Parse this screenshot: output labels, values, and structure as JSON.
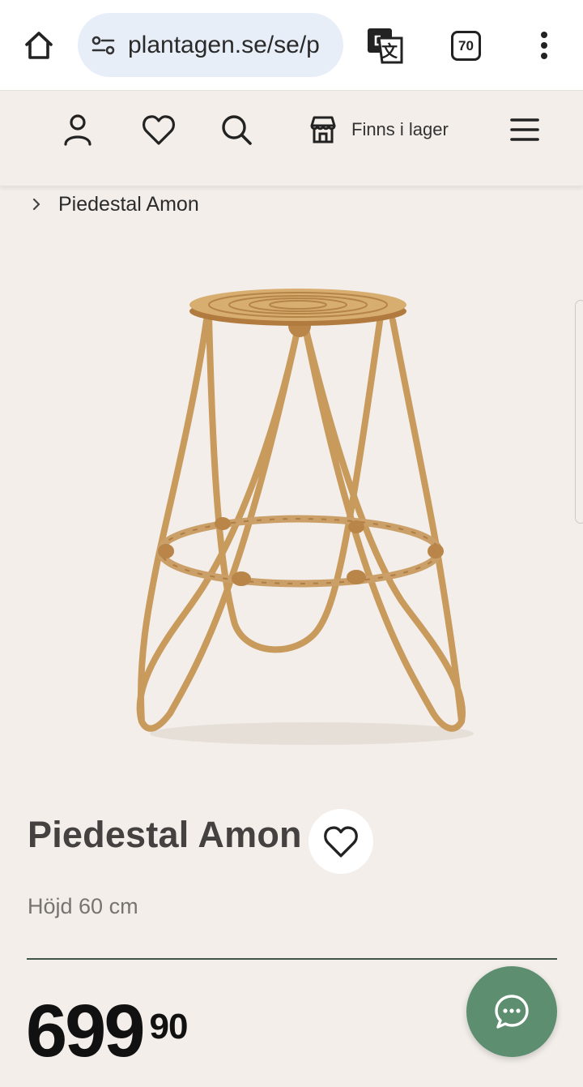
{
  "browser": {
    "url": "plantagen.se/se/p",
    "tab_count": "70"
  },
  "header": {
    "store_label": "Finns i lager"
  },
  "breadcrumb": {
    "current": "Piedestal Amon"
  },
  "product": {
    "title": "Piedestal Amon",
    "subtitle": "Höjd 60 cm",
    "price_main": "699",
    "price_decimals": "90"
  },
  "colors": {
    "background": "#f3eeea",
    "accent_green": "#5d8e70",
    "divider": "#3f5447"
  }
}
